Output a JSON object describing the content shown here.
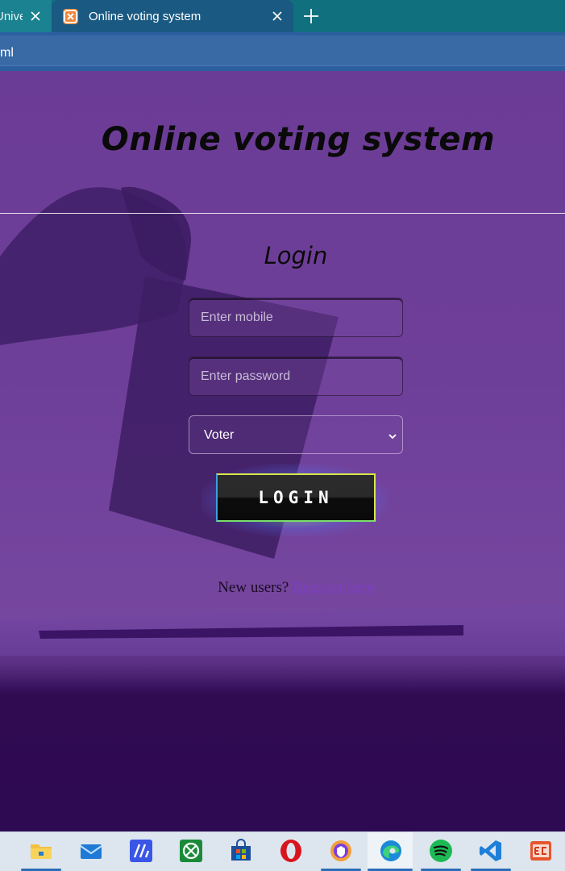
{
  "browser": {
    "tabs": [
      {
        "label": "Univer",
        "active": false
      },
      {
        "label": "Online voting system",
        "active": true
      }
    ],
    "address_fragment": "ml"
  },
  "page": {
    "site_title": "Online voting system",
    "login_heading": "Login",
    "mobile_placeholder": "Enter mobile",
    "password_placeholder": "Enter password",
    "role_selected": "Voter",
    "login_button": "LOGIN",
    "new_users_text": "New users?",
    "register_link": "Register here"
  },
  "taskbar": {
    "apps": [
      {
        "icon": "file-explorer-icon",
        "active": true
      },
      {
        "icon": "mail-icon",
        "active": false
      },
      {
        "icon": "aspect-app-icon",
        "active": false
      },
      {
        "icon": "xbox-icon",
        "active": false
      },
      {
        "icon": "store-icon",
        "active": false
      },
      {
        "icon": "opera-icon",
        "active": false
      },
      {
        "icon": "brave-vpn-icon",
        "active": false
      },
      {
        "icon": "edge-icon",
        "active": true
      },
      {
        "icon": "spotify-icon",
        "active": true
      },
      {
        "icon": "vscode-icon",
        "active": true
      },
      {
        "icon": "ec-app-icon",
        "active": false
      }
    ]
  },
  "colors": {
    "tab_bar": "#11707e",
    "active_tab": "#1a5a82",
    "page_purple": "#6e3f99",
    "page_dark": "#2e0a52",
    "link": "#7b3fc0",
    "taskbar": "#dde6ee"
  }
}
